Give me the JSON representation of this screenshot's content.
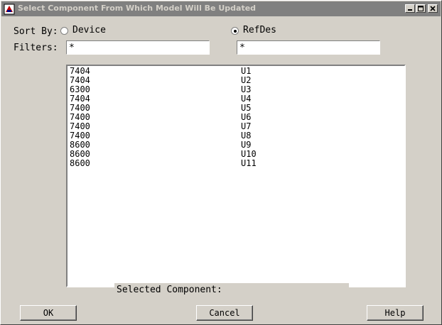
{
  "window": {
    "title": "Select Component From Which Model Will Be Updated"
  },
  "sort": {
    "label": "Sort By:",
    "options": [
      {
        "label": "Device",
        "selected": false
      },
      {
        "label": "RefDes",
        "selected": true
      }
    ]
  },
  "filters": {
    "label": "Filters:",
    "device_value": "*",
    "refdes_value": "*"
  },
  "components": [
    {
      "device": "7404",
      "refdes": "U1"
    },
    {
      "device": "7404",
      "refdes": "U2"
    },
    {
      "device": "6300",
      "refdes": "U3"
    },
    {
      "device": "7404",
      "refdes": "U4"
    },
    {
      "device": "7400",
      "refdes": "U5"
    },
    {
      "device": "7400",
      "refdes": "U6"
    },
    {
      "device": "7400",
      "refdes": "U7"
    },
    {
      "device": "7400",
      "refdes": "U8"
    },
    {
      "device": "8600",
      "refdes": "U9"
    },
    {
      "device": "8600",
      "refdes": "U10"
    },
    {
      "device": "8600",
      "refdes": "U11"
    }
  ],
  "selected_component": {
    "label": "Selected Component:"
  },
  "buttons": {
    "ok": "OK",
    "cancel": "Cancel",
    "help": "Help"
  }
}
